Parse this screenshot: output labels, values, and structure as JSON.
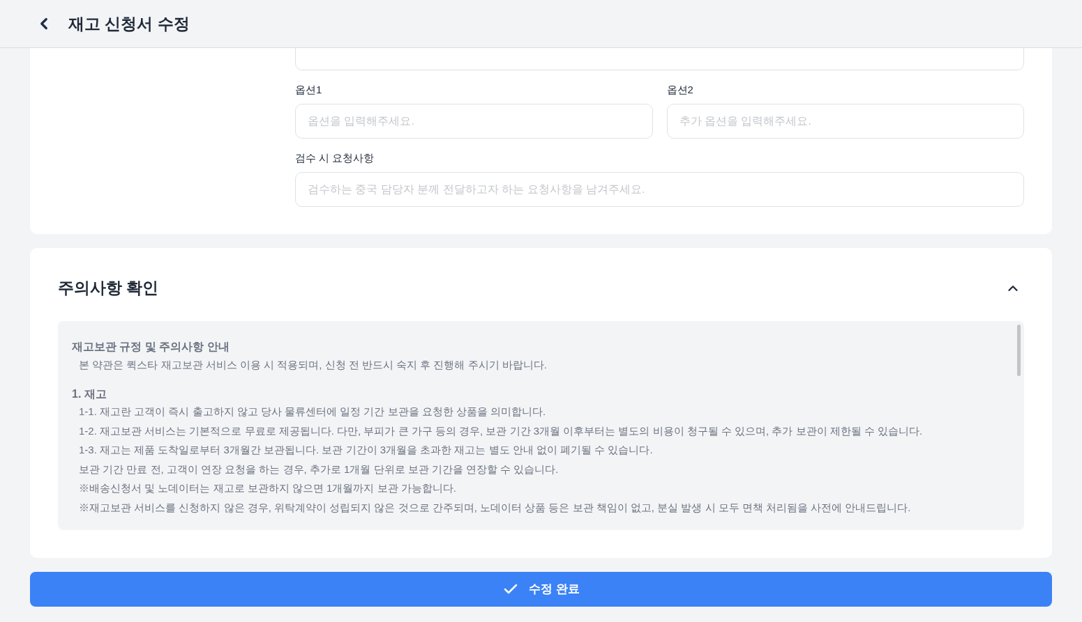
{
  "header": {
    "title": "재고 신청서 수정"
  },
  "form": {
    "option_fields": [
      {
        "label": "옵션1",
        "placeholder": "옵션을 입력해주세요."
      },
      {
        "label": "옵션2",
        "placeholder": "추가 옵션을 입력해주세요."
      }
    ],
    "request_field": {
      "label": "검수 시 요청사항",
      "placeholder": "검수하는 중국 담당자 분께 전달하고자 하는 요청사항을 남겨주세요."
    }
  },
  "notice": {
    "title": "주의사항 확인",
    "expanded": true,
    "heading": "재고보관 규정 및 주의사항 안내",
    "intro": "본 약관은 퀵스타 재고보관 서비스 이용 시 적용되며, 신청 전 반드시 숙지 후 진행해 주시기 바랍니다.",
    "sections": [
      {
        "title": "1. 재고",
        "lines": [
          "1-1. 재고란 고객이 즉시 출고하지 않고 당사 물류센터에 일정 기간 보관을 요청한 상품을 의미합니다.",
          "1-2. 재고보관 서비스는 기본적으로 무료로 제공됩니다. 다만, 부피가 큰 가구 등의 경우, 보관 기간 3개월 이후부터는 별도의 비용이 청구될 수 있으며, 추가 보관이 제한될 수 있습니다.",
          "1-3. 재고는 제품 도착일로부터 3개월간 보관됩니다. 보관 기간이 3개월을 초과한 재고는 별도 안내 없이 폐기될 수 있습니다.",
          "보관 기간 만료 전, 고객이 연장 요청을 하는 경우, 추가로 1개월 단위로 보관 기간을 연장할 수 있습니다.",
          "※배송신청서 및 노데이터는 재고로 보관하지 않으면 1개월까지 보관 가능합니다.",
          "※재고보관 서비스를 신청하지 않은 경우, 위탁계약이 성립되지 않은 것으로 간주되며, 노데이터 상품 등은 보관 책임이 없고, 분실 발생 시 모두 면책 처리됨을 사전에 안내드립니다."
        ]
      }
    ]
  },
  "submit": {
    "label": "수정 완료"
  }
}
